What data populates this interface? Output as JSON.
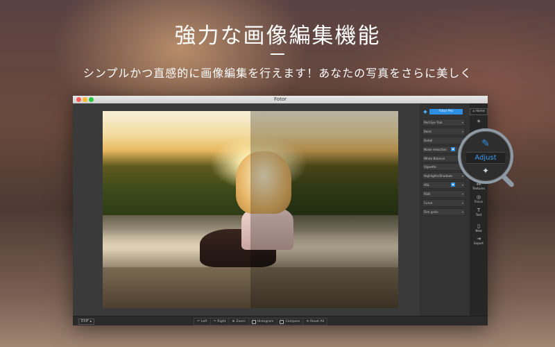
{
  "hero": {
    "title": "強力な画像編集機能",
    "subtitle": "シンプルかつ直感的に画像編集を行えます！あなたの写真をさらに美しく"
  },
  "window": {
    "title": "Fotor"
  },
  "panel": {
    "pro_button": "Fotor Pro",
    "items": [
      {
        "label": "Red Eye Tool"
      },
      {
        "label": "Basic"
      },
      {
        "label": "Detail"
      },
      {
        "label": "Noise reduction"
      },
      {
        "label": "White Balance"
      },
      {
        "label": "Vignette"
      },
      {
        "label": "Highlights/Shadows"
      },
      {
        "label": "HSL"
      },
      {
        "label": "RGB"
      },
      {
        "label": "Curve"
      },
      {
        "label": "Film grain"
      }
    ]
  },
  "rail": {
    "home": "Home",
    "items": [
      {
        "label": "Textures",
        "icon": "textures-icon"
      },
      {
        "label": "Focus",
        "icon": "focus-icon"
      },
      {
        "label": "Text",
        "icon": "text-icon"
      },
      {
        "label": "New",
        "icon": "new-file-icon"
      },
      {
        "label": "Export",
        "icon": "export-icon"
      }
    ]
  },
  "magnifier": {
    "label": "Adjust",
    "icons": [
      "pencil-icon",
      "sparkle-icon"
    ]
  },
  "statusbar": {
    "exif": "EXIF",
    "tools": [
      {
        "label": "Left",
        "icon": "rotate-left-icon"
      },
      {
        "label": "Right",
        "icon": "rotate-right-icon"
      },
      {
        "label": "Zoom",
        "icon": "zoom-icon"
      },
      {
        "label": "Histogram",
        "icon": "histogram-icon"
      },
      {
        "label": "Compare",
        "icon": "compare-icon"
      },
      {
        "label": "Reset All",
        "icon": "reset-icon"
      }
    ]
  },
  "colors": {
    "accent": "#2d8fe4",
    "panel_bg": "#333333",
    "rail_bg": "#262626"
  }
}
